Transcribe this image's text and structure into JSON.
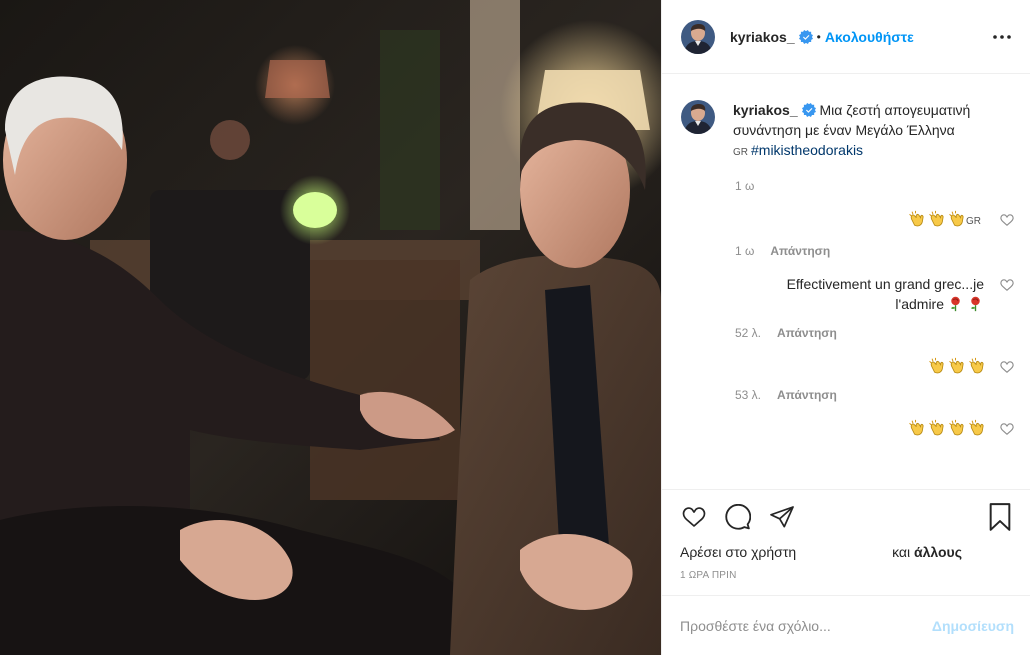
{
  "colors": {
    "accent": "#0095f6",
    "verified": "#3897f0",
    "muted": "#8e8e8e",
    "hashtag": "#00376b"
  },
  "header": {
    "username": "kyriakos_",
    "separator": "•",
    "follow_label": "Ακολουθήστε",
    "more_icon": "more-horizontal-icon"
  },
  "caption": {
    "username": "kyriakos_",
    "text": "Μια ζεστή απογευματινή συνάντηση με έναν Μεγάλο Έλληνα",
    "flag_text": "GR",
    "hashtag": "#mikistheodorakis",
    "timestamp": "1 ω"
  },
  "comments": [
    {
      "text": "",
      "emoji_count": 3,
      "emoji": "clapping-hands",
      "suffix": "GR",
      "timestamp": "1 ω",
      "reply": "Απάντηση"
    },
    {
      "text": "Effectivement un grand grec...je l'admire",
      "emoji_count": 2,
      "emoji": "rose",
      "suffix": "",
      "timestamp": "52 λ.",
      "reply": "Απάντηση"
    },
    {
      "text": "",
      "emoji_count": 3,
      "emoji": "clapping-hands",
      "suffix": "",
      "timestamp": "53 λ.",
      "reply": "Απάντηση"
    },
    {
      "text": "",
      "emoji_count": 4,
      "emoji": "clapping-hands",
      "suffix": "",
      "timestamp": "",
      "reply": ""
    }
  ],
  "actions": {
    "icons": [
      "heart-icon",
      "comment-icon",
      "share-icon",
      "bookmark-icon"
    ]
  },
  "likes": {
    "prefix": "Αρέσει στο χρήστη",
    "suffix_plain": "και",
    "suffix_bold": "άλλους"
  },
  "time_ago": "1 ΩΡΑ ΠΡΙΝ",
  "add_comment": {
    "placeholder": "Προσθέστε ένα σχόλιο...",
    "post_label": "Δημοσίευση"
  }
}
